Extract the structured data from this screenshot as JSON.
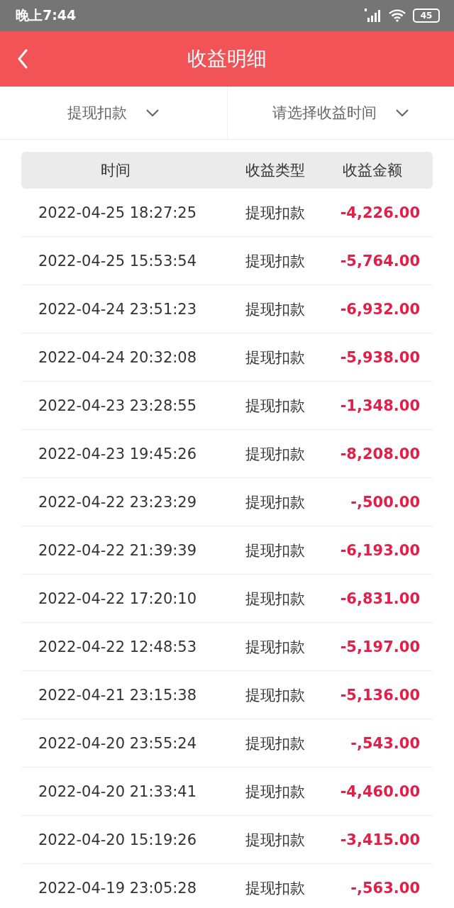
{
  "status_bar": {
    "time": "晚上7:44",
    "battery": "45"
  },
  "header": {
    "title": "收益明细"
  },
  "filters": [
    {
      "label": "提现扣款"
    },
    {
      "label": "请选择收益时间"
    }
  ],
  "table": {
    "columns": [
      "时间",
      "收益类型",
      "收益金额"
    ],
    "rows": [
      {
        "time": "2022-04-25 18:27:25",
        "type": "提现扣款",
        "amount": "-4,226.00"
      },
      {
        "time": "2022-04-25 15:53:54",
        "type": "提现扣款",
        "amount": "-5,764.00"
      },
      {
        "time": "2022-04-24 23:51:23",
        "type": "提现扣款",
        "amount": "-6,932.00"
      },
      {
        "time": "2022-04-24 20:32:08",
        "type": "提现扣款",
        "amount": "-5,938.00"
      },
      {
        "time": "2022-04-23 23:28:55",
        "type": "提现扣款",
        "amount": "-1,348.00"
      },
      {
        "time": "2022-04-23 19:45:26",
        "type": "提现扣款",
        "amount": "-8,208.00"
      },
      {
        "time": "2022-04-22 23:23:29",
        "type": "提现扣款",
        "amount": "-,500.00"
      },
      {
        "time": "2022-04-22 21:39:39",
        "type": "提现扣款",
        "amount": "-6,193.00"
      },
      {
        "time": "2022-04-22 17:20:10",
        "type": "提现扣款",
        "amount": "-6,831.00"
      },
      {
        "time": "2022-04-22 12:48:53",
        "type": "提现扣款",
        "amount": "-5,197.00"
      },
      {
        "time": "2022-04-21 23:15:38",
        "type": "提现扣款",
        "amount": "-5,136.00"
      },
      {
        "time": "2022-04-20 23:55:24",
        "type": "提现扣款",
        "amount": "-,543.00"
      },
      {
        "time": "2022-04-20 21:33:41",
        "type": "提现扣款",
        "amount": "-4,460.00"
      },
      {
        "time": "2022-04-20 15:19:26",
        "type": "提现扣款",
        "amount": "-3,415.00"
      },
      {
        "time": "2022-04-19 23:05:28",
        "type": "提现扣款",
        "amount": "-,563.00"
      }
    ]
  }
}
